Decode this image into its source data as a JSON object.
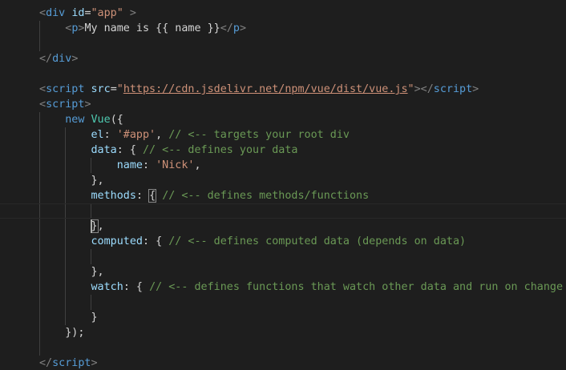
{
  "editor": {
    "lines": [
      [
        {
          "t": "<",
          "c": "punct"
        },
        {
          "t": "div",
          "c": "tag"
        },
        {
          "t": " ",
          "c": "text"
        },
        {
          "t": "id",
          "c": "attr"
        },
        {
          "t": "=",
          "c": "text"
        },
        {
          "t": "\"app\"",
          "c": "str"
        },
        {
          "t": " ",
          "c": "text"
        },
        {
          "t": ">",
          "c": "punct"
        }
      ],
      [
        {
          "t": "    ",
          "c": "text"
        },
        {
          "t": "<",
          "c": "punct"
        },
        {
          "t": "p",
          "c": "tag"
        },
        {
          "t": ">",
          "c": "punct"
        },
        {
          "t": "My name is {{ name }}",
          "c": "text"
        },
        {
          "t": "</",
          "c": "punct"
        },
        {
          "t": "p",
          "c": "tag"
        },
        {
          "t": ">",
          "c": "punct"
        }
      ],
      [],
      [
        {
          "t": "</",
          "c": "punct"
        },
        {
          "t": "div",
          "c": "tag"
        },
        {
          "t": ">",
          "c": "punct"
        }
      ],
      [],
      [
        {
          "t": "<",
          "c": "punct"
        },
        {
          "t": "script",
          "c": "tag"
        },
        {
          "t": " ",
          "c": "text"
        },
        {
          "t": "src",
          "c": "attr"
        },
        {
          "t": "=",
          "c": "text"
        },
        {
          "t": "\"",
          "c": "str"
        },
        {
          "t": "https://cdn.jsdelivr.net/npm/vue/dist/vue.js",
          "c": "link"
        },
        {
          "t": "\"",
          "c": "str"
        },
        {
          "t": "></",
          "c": "punct"
        },
        {
          "t": "script",
          "c": "tag"
        },
        {
          "t": ">",
          "c": "punct"
        }
      ],
      [
        {
          "t": "<",
          "c": "punct"
        },
        {
          "t": "script",
          "c": "tag"
        },
        {
          "t": ">",
          "c": "punct"
        }
      ],
      [
        {
          "t": "    ",
          "c": "text"
        },
        {
          "t": "new",
          "c": "kw"
        },
        {
          "t": " ",
          "c": "text"
        },
        {
          "t": "Vue",
          "c": "cls"
        },
        {
          "t": "({",
          "c": "text"
        }
      ],
      [
        {
          "t": "        ",
          "c": "text"
        },
        {
          "t": "el",
          "c": "attr"
        },
        {
          "t": ": ",
          "c": "text"
        },
        {
          "t": "'#app'",
          "c": "str"
        },
        {
          "t": ", ",
          "c": "text"
        },
        {
          "t": "// <-- targets your root div",
          "c": "cmt"
        }
      ],
      [
        {
          "t": "        ",
          "c": "text"
        },
        {
          "t": "data",
          "c": "attr"
        },
        {
          "t": ": { ",
          "c": "text"
        },
        {
          "t": "// <-- defines your data",
          "c": "cmt"
        }
      ],
      [
        {
          "t": "            ",
          "c": "text"
        },
        {
          "t": "name",
          "c": "attr"
        },
        {
          "t": ": ",
          "c": "text"
        },
        {
          "t": "'Nick'",
          "c": "str"
        },
        {
          "t": ",",
          "c": "text"
        }
      ],
      [
        {
          "t": "        },",
          "c": "text"
        }
      ],
      [
        {
          "t": "        ",
          "c": "text"
        },
        {
          "t": "methods",
          "c": "attr"
        },
        {
          "t": ": ",
          "c": "text"
        },
        {
          "t": "{",
          "c": "text",
          "m": true
        },
        {
          "t": " ",
          "c": "text"
        },
        {
          "t": "// <-- defines methods/functions",
          "c": "cmt"
        }
      ],
      [],
      [
        {
          "t": "        ",
          "c": "text"
        },
        {
          "t": "}",
          "c": "text",
          "m": true
        },
        {
          "t": ",",
          "c": "text"
        }
      ],
      [
        {
          "t": "        ",
          "c": "text"
        },
        {
          "t": "computed",
          "c": "attr"
        },
        {
          "t": ": { ",
          "c": "text"
        },
        {
          "t": "// <-- defines computed data (depends on data)",
          "c": "cmt"
        }
      ],
      [],
      [
        {
          "t": "        },",
          "c": "text"
        }
      ],
      [
        {
          "t": "        ",
          "c": "text"
        },
        {
          "t": "watch",
          "c": "attr"
        },
        {
          "t": ": { ",
          "c": "text"
        },
        {
          "t": "// <-- defines functions that watch other data and run on change",
          "c": "cmt"
        }
      ],
      [],
      [
        {
          "t": "        }",
          "c": "text"
        }
      ],
      [
        {
          "t": "    });",
          "c": "text"
        }
      ],
      [],
      [
        {
          "t": "</",
          "c": "punct"
        },
        {
          "t": "script",
          "c": "tag"
        },
        {
          "t": ">",
          "c": "punct"
        }
      ]
    ]
  }
}
